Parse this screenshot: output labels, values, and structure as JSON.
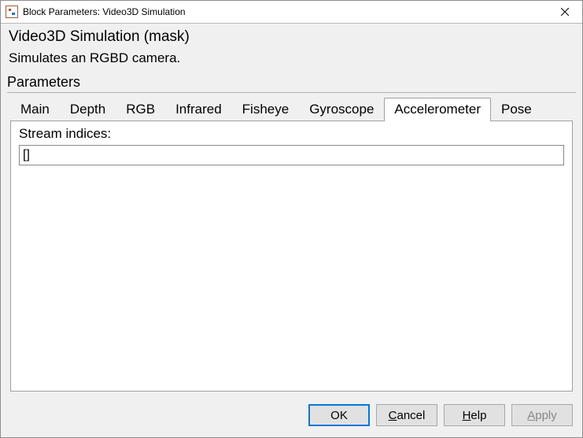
{
  "window": {
    "title": "Block Parameters: Video3D Simulation"
  },
  "mask": {
    "title": "Video3D Simulation (mask)",
    "description": "Simulates an RGBD camera."
  },
  "parameters": {
    "group_label": "Parameters",
    "tabs": [
      {
        "label": "Main"
      },
      {
        "label": "Depth"
      },
      {
        "label": "RGB"
      },
      {
        "label": "Infrared"
      },
      {
        "label": "Fisheye"
      },
      {
        "label": "Gyroscope"
      },
      {
        "label": "Accelerometer",
        "active": true
      },
      {
        "label": "Pose"
      }
    ],
    "accelerometer": {
      "stream_indices_label": "Stream indices:",
      "stream_indices_value": "[]"
    }
  },
  "buttons": {
    "ok": "OK",
    "cancel": "Cancel",
    "help": "Help",
    "apply": "Apply"
  }
}
